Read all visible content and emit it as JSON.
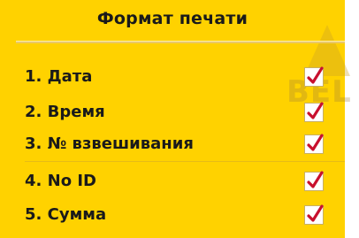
{
  "header": {
    "title": "Формат печати"
  },
  "watermark": "BEL",
  "print_options": [
    {
      "label": "1. Дата",
      "checked": true
    },
    {
      "label": "2. Время",
      "checked": true
    },
    {
      "label": "3. № взвешивания",
      "checked": true
    },
    {
      "label": "4. No ID",
      "checked": true
    },
    {
      "label": "5. Сумма",
      "checked": true
    }
  ],
  "colors": {
    "background": "#ffd200",
    "checkmark": "#c8102e",
    "text": "#1a1a1a"
  }
}
